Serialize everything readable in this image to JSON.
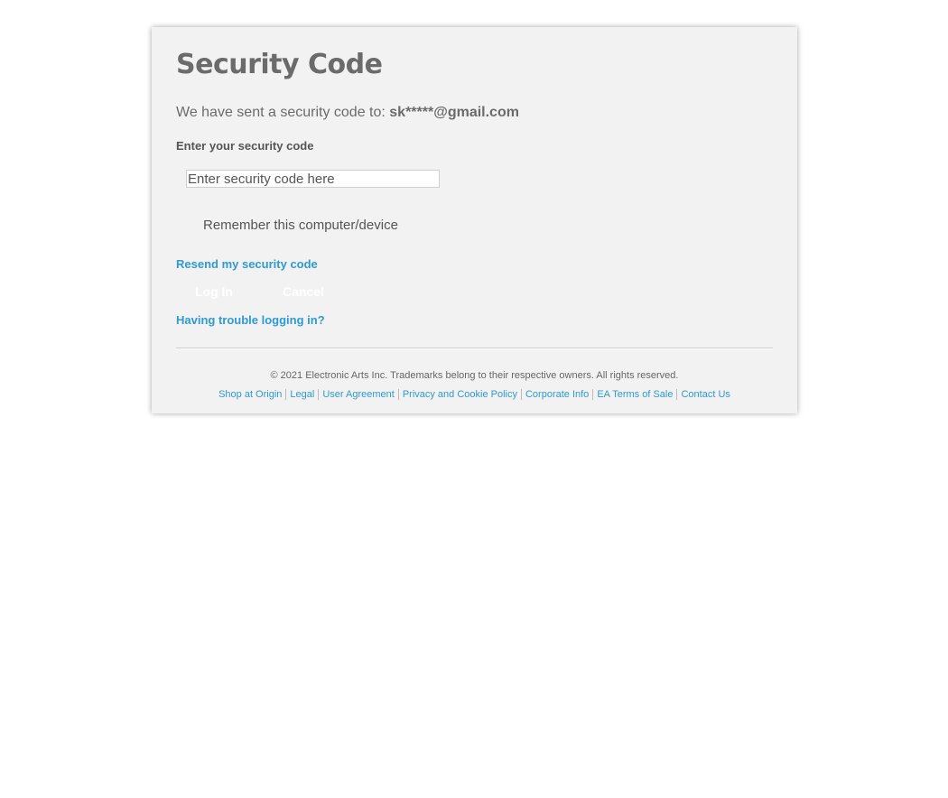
{
  "page": {
    "title": "Security Code",
    "sent_prefix": "We have sent a security code to:",
    "email": "sk*****@gmail.com"
  },
  "form": {
    "code_label": "Enter your security code",
    "code_placeholder": "Enter security code here",
    "remember_label": "Remember this computer/device",
    "resend_link": "Resend my security code",
    "login_button": "Log In",
    "cancel_button": "Cancel",
    "trouble_link": "Having trouble logging in?"
  },
  "footer": {
    "copyright": "© 2021 Electronic Arts Inc. Trademarks belong to their respective owners. All rights reserved.",
    "links": [
      "Shop at Origin",
      "Legal",
      "User Agreement",
      "Privacy and Cookie Policy",
      "Corporate Info",
      "EA Terms of Sale",
      "Contact Us"
    ]
  },
  "colors": {
    "link": "#2e9ad6",
    "panel_bg": "#f2f2f2",
    "text": "#6b6b6b"
  }
}
